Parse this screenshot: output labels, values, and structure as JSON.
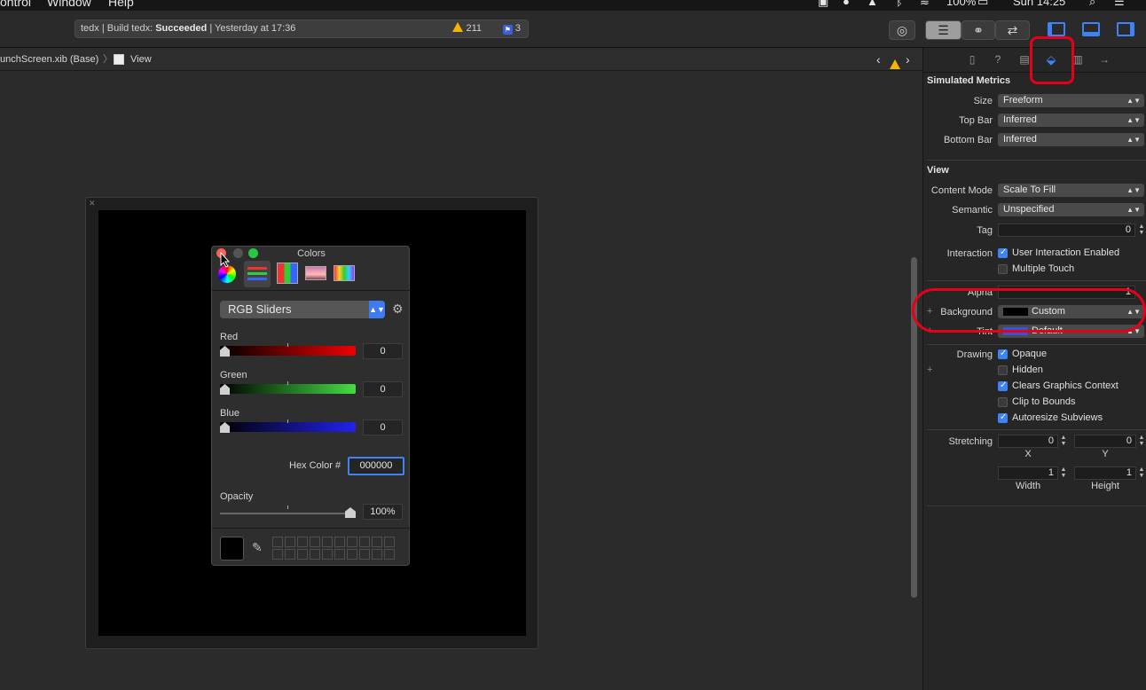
{
  "menubar": {
    "items": [
      "ontrol",
      "Window",
      "Help"
    ],
    "battery": "100%",
    "clock": "Sun 14:25"
  },
  "toolbar": {
    "status_prefix": "tedx | Build tedx: ",
    "status_result": "Succeeded",
    "status_suffix": " | Yesterday at 17:36",
    "warnings": "211",
    "issues": "3"
  },
  "jumpbar": {
    "file": "unchScreen.xib (Base)",
    "item": "View"
  },
  "colors_panel": {
    "title": "Colors",
    "mode": "RGB Sliders",
    "red_label": "Red",
    "red_value": "0",
    "green_label": "Green",
    "green_value": "0",
    "blue_label": "Blue",
    "blue_value": "0",
    "hex_label": "Hex Color #",
    "hex_value": "000000",
    "opacity_label": "Opacity",
    "opacity_value": "100%",
    "opacity_fraction": 1.0,
    "current_color": "#000000"
  },
  "inspector": {
    "simulated_metrics": {
      "title": "Simulated Metrics",
      "size_label": "Size",
      "size_value": "Freeform",
      "topbar_label": "Top Bar",
      "topbar_value": "Inferred",
      "bottombar_label": "Bottom Bar",
      "bottombar_value": "Inferred"
    },
    "view": {
      "title": "View",
      "content_mode_label": "Content Mode",
      "content_mode_value": "Scale To Fill",
      "semantic_label": "Semantic",
      "semantic_value": "Unspecified",
      "tag_label": "Tag",
      "tag_value": "0",
      "interaction_label": "Interaction",
      "user_interaction": "User Interaction Enabled",
      "multiple_touch": "Multiple Touch",
      "alpha_label": "Alpha",
      "alpha_value": "1",
      "background_label": "Background",
      "background_value": "Custom",
      "tint_label": "Tint",
      "tint_value": "Default",
      "drawing_label": "Drawing",
      "opaque": "Opaque",
      "hidden": "Hidden",
      "clears_context": "Clears Graphics Context",
      "clip_bounds": "Clip to Bounds",
      "autoresize": "Autoresize Subviews",
      "stretching_label": "Stretching",
      "stretch_x": "0",
      "stretch_y": "0",
      "x_label": "X",
      "y_label": "Y",
      "stretch_w": "1",
      "stretch_h": "1",
      "width_label": "Width",
      "height_label": "Height"
    }
  },
  "colors": {
    "accent": "#3f82f5",
    "annotation": "#e6001a",
    "warning": "#f4b400"
  }
}
